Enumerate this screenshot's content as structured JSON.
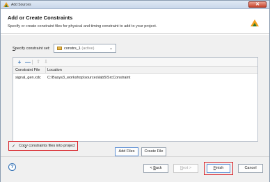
{
  "window": {
    "title": "Add Sources",
    "close_label": "✕"
  },
  "header": {
    "title": "Add or Create Constraints",
    "subtitle": "Specify or create constraint files for physical and timing constraint to add to your project."
  },
  "constraint_set": {
    "label_first": "S",
    "label_rest": "pecify constraint set:",
    "value": "constrs_1",
    "status": "(active)"
  },
  "toolbar": {
    "add": "+",
    "remove": "—",
    "up": "⇧",
    "down": "⇩"
  },
  "table": {
    "columns": [
      "Constraint File",
      "Location"
    ],
    "rows": [
      [
        "signal_gen.xdc",
        "C:\\Basys3_workshop\\sources\\lab5\\SrcConstraint"
      ]
    ]
  },
  "actions": {
    "add_files": "Add Files",
    "create_file": "Create File"
  },
  "copy_option": {
    "checked": true,
    "label_pre": "Co",
    "label_underlined": "p",
    "label_post": "y constraints files into project"
  },
  "footer": {
    "help": "?",
    "back_underlined": "B",
    "back_pre": "< ",
    "back_post": "ack",
    "next_underlined": "N",
    "next_post": "ext >",
    "finish_underlined": "F",
    "finish_post": "inish",
    "cancel": "Cancel"
  },
  "colors": {
    "highlight": "#d8232a",
    "accent": "#2b6cb3"
  }
}
